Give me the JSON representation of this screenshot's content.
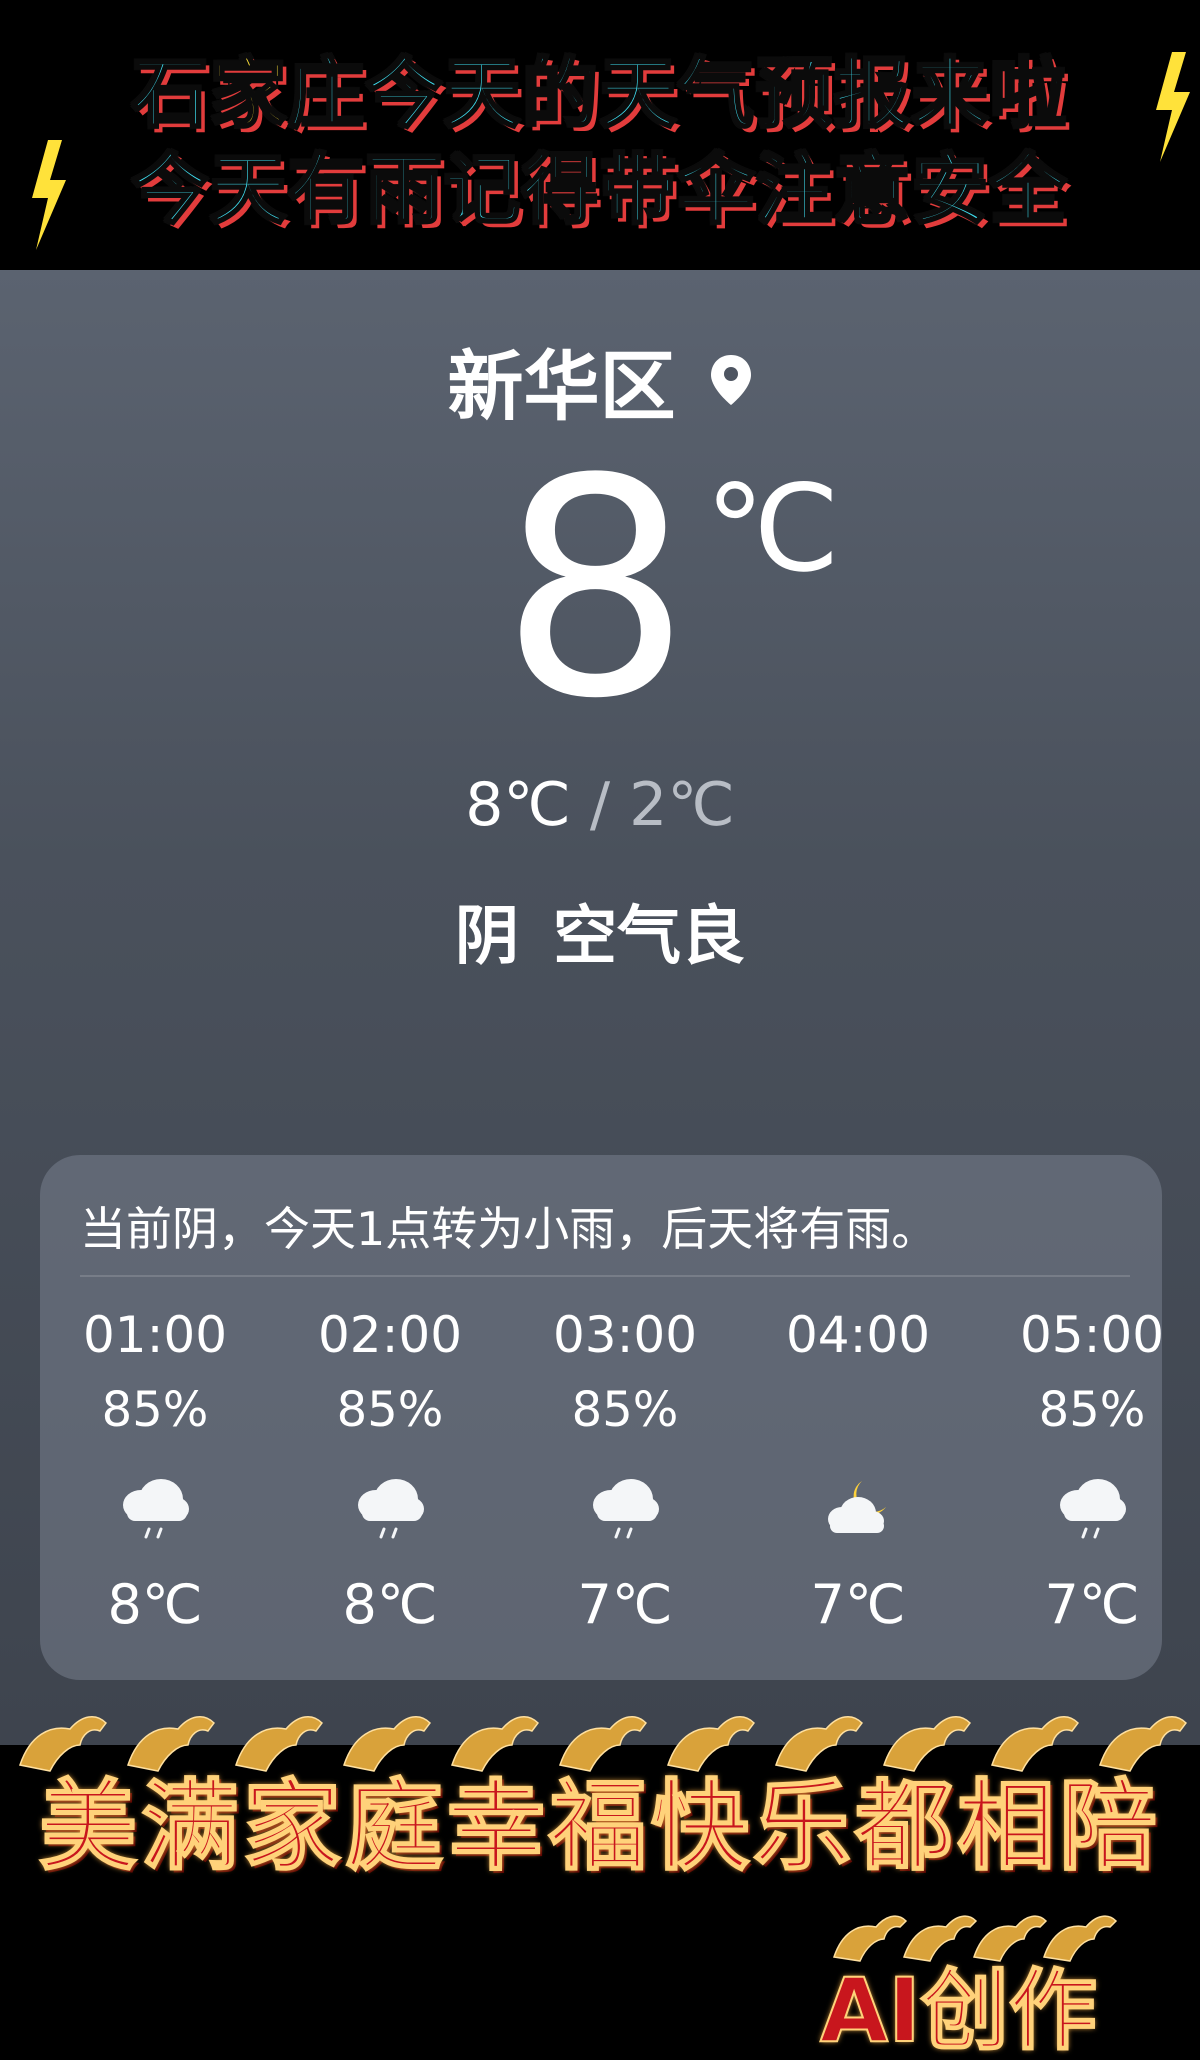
{
  "top_banner": {
    "line1_pre": "石",
    "line1_highlight": "家",
    "line1_post": "庄今天的天气预报来啦",
    "line2": "今天有雨记得带伞注意安全",
    "text_color": "#3fe0f2",
    "highlight_color": "#ffe23a",
    "shadow_color": "#e23c3c"
  },
  "weather": {
    "location": "新华区",
    "location_icon": "location-pin-icon",
    "current_temp": "8",
    "temp_unit": "℃",
    "high": "8℃",
    "separator": " / ",
    "low": "2℃",
    "condition": "阴",
    "air_quality": "空气良",
    "background_top": "#5b6370",
    "background_bottom": "#3e444e"
  },
  "forecast": {
    "summary": "当前阴，今天1点转为小雨，后天将有雨。",
    "hours": [
      {
        "time": "01:00",
        "prob": "85%",
        "icon": "light-rain-icon",
        "temp": "8℃"
      },
      {
        "time": "02:00",
        "prob": "85%",
        "icon": "light-rain-icon",
        "temp": "8℃"
      },
      {
        "time": "03:00",
        "prob": "85%",
        "icon": "light-rain-icon",
        "temp": "7℃"
      },
      {
        "time": "04:00",
        "prob": "",
        "icon": "partly-cloudy-night-icon",
        "temp": "7℃"
      },
      {
        "time": "05:00",
        "prob": "85%",
        "icon": "light-rain-icon",
        "temp": "7℃"
      }
    ]
  },
  "bottom_banner": {
    "slogan": "美满家庭幸福快乐都相陪",
    "signature": "AI创作",
    "decoration_icon": "golden-horse-icon",
    "text_color": "#c8161d",
    "outline_color": "#ffd27a"
  }
}
